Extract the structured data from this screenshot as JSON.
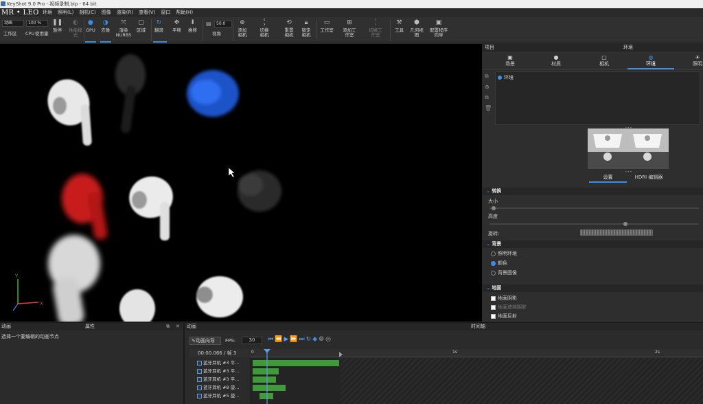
{
  "window": {
    "title": "KeyShot 9.0 Pro  -  视频录制.bip  -  64 bit"
  },
  "logo_text": "MR • LEO",
  "menu": [
    "环境",
    "照明(L)",
    "相机(C)",
    "图像",
    "渲染(R)",
    "查看(V)",
    "窗口",
    "帮助(H)"
  ],
  "toolbar": {
    "workspace_field": "动画",
    "zoom_field": "100 %",
    "angle_value": "50.0",
    "buttons": {
      "workspace": "工作区",
      "cpu": "CPU",
      "usage": "使用量",
      "pause": "暂停",
      "perf_mode": "性能模式",
      "gpu": "GPU",
      "denoise": "去噪",
      "render_nurbs": "渲染NURBS",
      "region": "区域",
      "tumble": "翻滚",
      "pan": "平移",
      "dolly": "推移",
      "fov": "视角",
      "add_camera": "添加相机",
      "switch_camera": "切换相机",
      "reset_camera": "重置相机",
      "lock_camera": "锁定相机",
      "studio": "工作室",
      "add_studio": "添加工作室",
      "switch_studio": "切换工作室",
      "tools": "工具",
      "geometry_view": "几何视图",
      "config_wizard": "配置程序向导"
    }
  },
  "right_panel": {
    "header_left": "项目",
    "header_title": "环境",
    "tabs": [
      "场景",
      "材质",
      "相机",
      "环境",
      "照明"
    ],
    "active_tab": "环境",
    "env_list": [
      "环境"
    ],
    "subtabs": [
      "设置",
      "HDRI 编辑器"
    ],
    "transform": {
      "title": "转换",
      "size": "大小",
      "height": "高度",
      "rotation": "旋转:"
    },
    "background": {
      "title": "背景",
      "options": [
        "照明环境",
        "颜色",
        "背景图像"
      ],
      "selected": "颜色"
    },
    "ground": {
      "title": "地面",
      "options": [
        "地面阴影",
        "地面遮挡阴影",
        "地面反射"
      ]
    }
  },
  "bottom_left": {
    "left_header": "动画",
    "right_header": "属性",
    "hint": "选择一个要编辑的动画节点"
  },
  "timeline": {
    "left_header": "动画",
    "title": "时间轴",
    "wizard_button": "动画向导",
    "fps_label": "FPS:",
    "fps_value": "30",
    "timecode": "00:00.066 / 帧 3",
    "ruler": [
      "0",
      "1s",
      "2s"
    ],
    "tracks": [
      "蓝牙耳机 #3 平...",
      "蓝牙耳机 #3 平...",
      "蓝牙耳机 #3 平...",
      "蓝牙耳机 #8 旋...",
      "蓝牙耳机 #5 旋..."
    ]
  },
  "colors": {
    "accent": "#3d8fe6",
    "keyframe_green": "#3f9b3a",
    "viewport_bg": "#000000"
  }
}
